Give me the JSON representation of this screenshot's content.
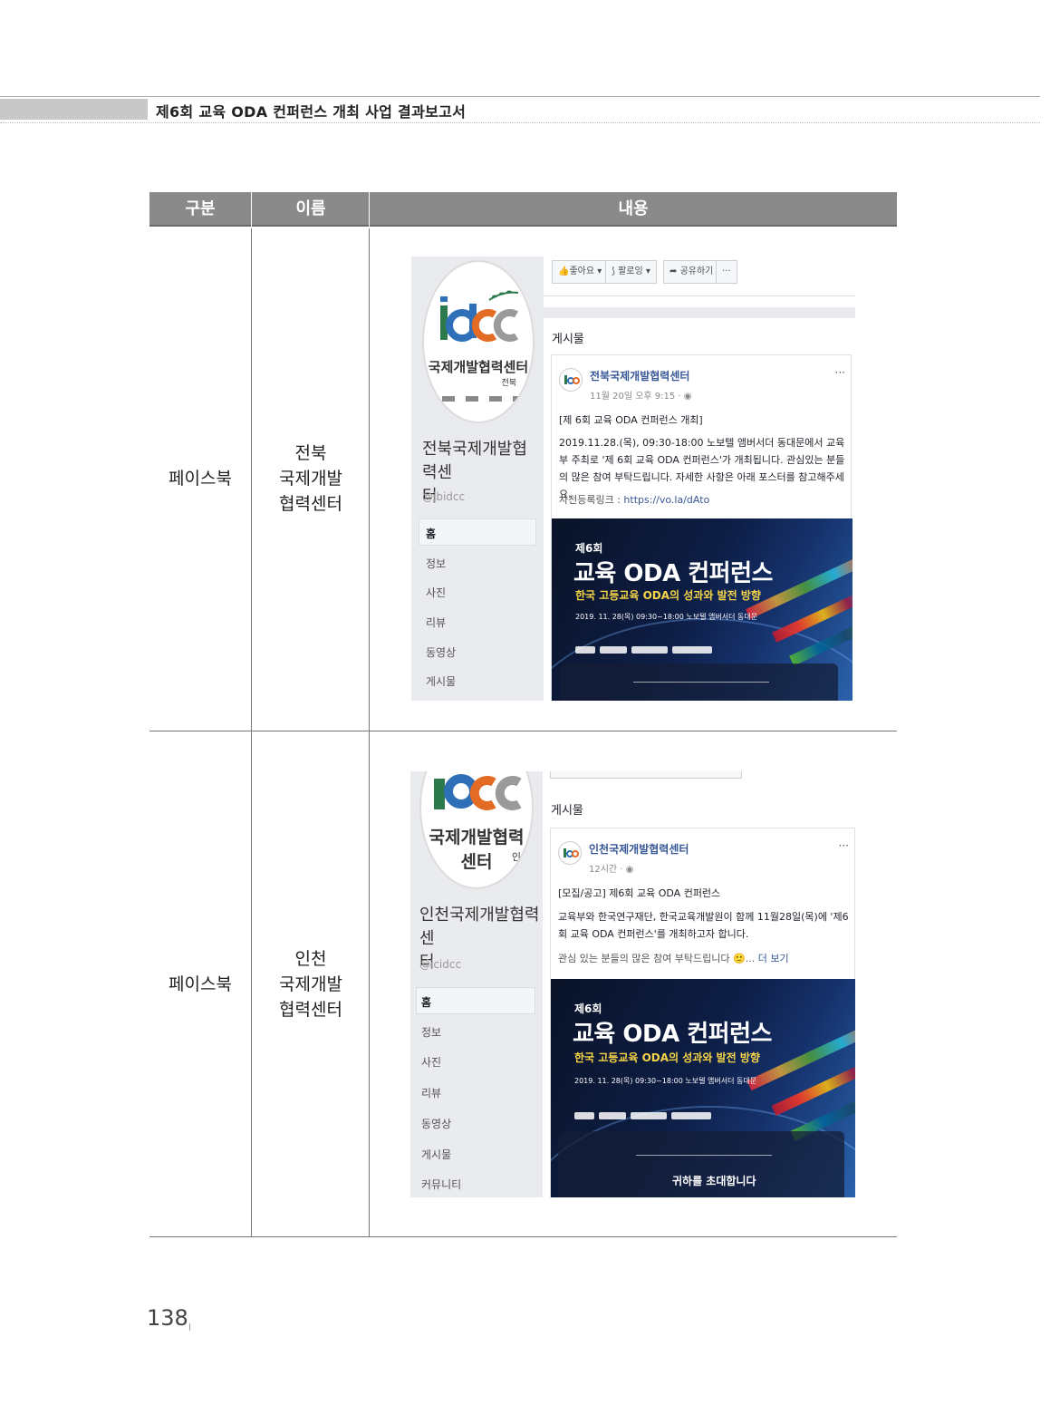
{
  "header": {
    "title": "제6회 교육 ODA 컨퍼런스 개최 사업 결과보고서"
  },
  "table": {
    "headers": [
      "구분",
      "이름",
      "내용"
    ],
    "rows": [
      {
        "category": "페이스북",
        "name": "전북\n국제개발\n협력센터",
        "shot": {
          "logo_text": "국제개발협력센터",
          "logo_region": "전북",
          "page_name": "전북국제개발협력센\n터",
          "handle": "@jbidcc",
          "nav": [
            "홈",
            "정보",
            "사진",
            "리뷰",
            "동영상",
            "게시물"
          ],
          "buttons": [
            "좋아요 ▾",
            "팔로잉 ▾",
            "공유하기",
            "···"
          ],
          "section_title": "게시물",
          "post": {
            "author": "전북국제개발협력센터",
            "meta": "11월 20일 오후 9:15 · ◉",
            "line1": "[제 6회 교육 ODA 컨퍼런스 개최]",
            "body": "2019.11.28.(목), 09:30-18:00 노보텔 앰버서더 동대문에서 교육부 주최로 '제 6회 교육 ODA 컨퍼런스'가 개최됩니다. 관심있는 분들의 많은 참여 부탁드립니다. 자세한 사항은 아래 포스터를 참고해주세요.",
            "link_label": "사전등록링크 : ",
            "link": "https://vo.la/dAto",
            "dots": "···"
          },
          "poster": {
            "kicker": "제6회",
            "title": "교육 ODA 컨퍼런스",
            "subtitle": "한국 고등교육 ODA의 성과와 발전 방향",
            "date": "2019. 11. 28(목) 09:30~18:00   노보텔 앰버서더 동대문"
          }
        }
      },
      {
        "category": "페이스북",
        "name": "인천\n국제개발\n협력센터",
        "shot": {
          "logo_text": "국제개발협력센터",
          "logo_region": "인",
          "page_name": "인천국제개발협력센\n터",
          "handle": "@icidcc",
          "nav": [
            "홈",
            "정보",
            "사진",
            "리뷰",
            "동영상",
            "게시물",
            "커뮤니티"
          ],
          "section_title": "게시물",
          "post": {
            "author": "인천국제개발협력센터",
            "meta": "12시간 · ◉",
            "line1": "[모집/공고] 제6회 교육 ODA 컨퍼런스",
            "body": "교육부와 한국연구재단, 한국교육개발원이 함께 11월28일(목)에 '제6회 교육 ODA 컨퍼런스'를 개최하고자 합니다.",
            "line3": "관심 있는 분들의 많은 참여 부탁드립니다 🙂... ",
            "more": "더 보기",
            "dots": "···"
          },
          "poster": {
            "kicker": "제6회",
            "title": "교육 ODA 컨퍼런스",
            "subtitle": "한국 고등교육 ODA의 성과와 발전 방향",
            "date": "2019. 11. 28(목) 09:30~18:00   노보텔 앰버서더 동대문",
            "invite": "귀하를 초대합니다"
          }
        }
      }
    ]
  },
  "footer": {
    "page_number": "138"
  },
  "colors": {
    "header_bg": "#8a8a8a",
    "fb_blue": "#385898",
    "poster_yellow": "#f7d547"
  }
}
